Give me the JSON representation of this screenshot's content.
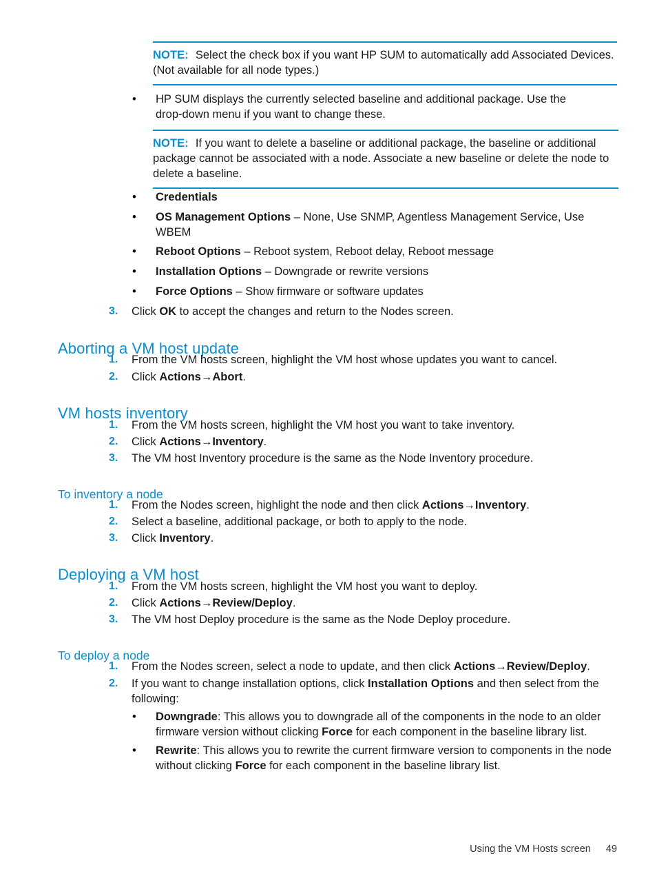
{
  "document": {
    "note_label": "NOTE:",
    "bullet_glyph": "•",
    "arrow_glyph": "→",
    "accent_color": "#0b8ed0"
  },
  "notes": [
    {
      "label": "NOTE:",
      "text": "Select the check box if you want HP SUM to automatically add Associated Devices. (Not available for all node types.)"
    },
    {
      "label": "NOTE:",
      "text": "If you want to delete a baseline or additional package, the baseline or additional package cannot be associated with a node. Associate a new baseline or delete the node to delete a baseline."
    }
  ],
  "intro_bullet": {
    "text": "HP SUM displays the currently selected baseline and additional package. Use the drop-down menu if you want to change these."
  },
  "options_bullets": [
    {
      "term": "Credentials",
      "rest": ""
    },
    {
      "term": "OS Management Options",
      "rest": " – None, Use SNMP, Agentless Management Service, Use WBEM"
    },
    {
      "term": "Reboot Options",
      "rest": " – Reboot system, Reboot delay, Reboot message"
    },
    {
      "term": "Installation Options",
      "rest": " – Downgrade or rewrite versions"
    },
    {
      "term": "Force Options",
      "rest": " – Show firmware or software updates"
    }
  ],
  "step3_ok": {
    "number": "3.",
    "pre": "Click ",
    "bold": "OK",
    "post": " to accept the changes and return to the Nodes screen."
  },
  "sections": {
    "aborting": {
      "heading": "Aborting a VM host update",
      "steps": [
        {
          "number": "1.",
          "pre": "From the VM hosts screen, highlight the VM host whose updates you want to cancel.",
          "bold": "",
          "post": ""
        },
        {
          "number": "2.",
          "pre": "Click ",
          "bold": "Actions→Abort",
          "post": "."
        }
      ]
    },
    "vm_hosts_inventory": {
      "heading": "VM hosts inventory",
      "steps": [
        {
          "number": "1.",
          "pre": "From the VM hosts screen, highlight the VM host you want to take inventory.",
          "bold": "",
          "post": ""
        },
        {
          "number": "2.",
          "pre": "Click ",
          "bold": "Actions→Inventory",
          "post": "."
        },
        {
          "number": "3.",
          "pre": "The VM host Inventory procedure is the same as the Node Inventory procedure.",
          "bold": "",
          "post": ""
        }
      ]
    },
    "to_inventory_node": {
      "heading": "To inventory a node",
      "steps": [
        {
          "number": "1.",
          "pre": "From the Nodes screen, highlight the node and then click ",
          "bold": "Actions→Inventory",
          "post": "."
        },
        {
          "number": "2.",
          "pre": "Select a baseline, additional package, or both to apply to the node.",
          "bold": "",
          "post": ""
        },
        {
          "number": "3.",
          "pre": "Click ",
          "bold": "Inventory",
          "post": "."
        }
      ]
    },
    "deploying": {
      "heading": "Deploying a VM host",
      "steps": [
        {
          "number": "1.",
          "pre": "From the VM hosts screen, highlight the VM host you want to deploy.",
          "bold": "",
          "post": ""
        },
        {
          "number": "2.",
          "pre": "Click ",
          "bold": "Actions→Review/Deploy",
          "post": "."
        },
        {
          "number": "3.",
          "pre": "The VM host Deploy procedure is the same as the Node Deploy procedure.",
          "bold": "",
          "post": ""
        }
      ]
    },
    "to_deploy_node": {
      "heading": "To deploy a node",
      "steps": [
        {
          "number": "1.",
          "pre": "From the Nodes screen, select a node to update, and then click ",
          "bold": "Actions→Review/Deploy",
          "post": "."
        },
        {
          "number": "2.",
          "pre": "If you want to change installation options, click ",
          "bold": "Installation Options",
          "post": " and then select from the following:"
        }
      ],
      "sub_bullets": [
        {
          "term": "Downgrade",
          "part1": ": This allows you to downgrade all of the components in the node to an older firmware version without clicking ",
          "bold2": "Force",
          "part2": " for each component in the baseline library list."
        },
        {
          "term": "Rewrite",
          "part1": ": This allows you to rewrite the current firmware version to components in the node without clicking ",
          "bold2": "Force",
          "part2": " for each component in the baseline library list."
        }
      ]
    }
  },
  "footer": {
    "title": "Using the VM Hosts screen",
    "page_number": "49"
  }
}
